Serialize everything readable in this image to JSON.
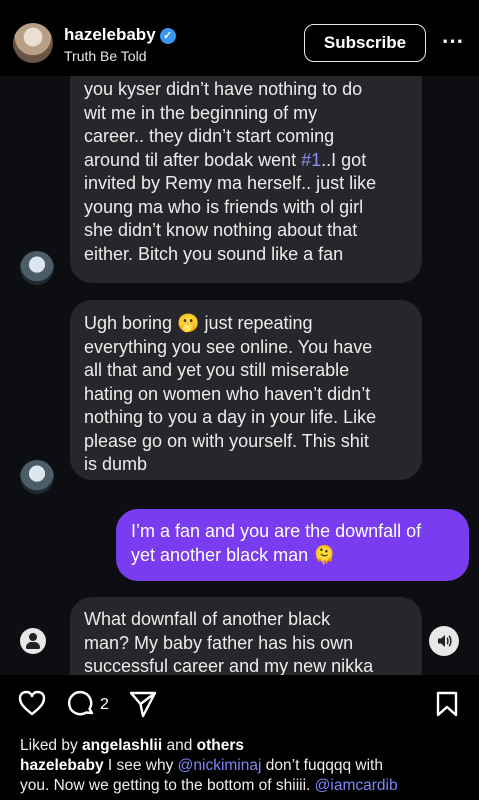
{
  "header": {
    "username": "hazelebaby",
    "verified_mark": "✓",
    "subtitle": "Truth Be Told",
    "subscribe_label": "Subscribe",
    "more_icon": "⋯"
  },
  "messages": [
    {
      "lines": [
        "you kyser didn’t have nothing to do",
        "wit me in the beginning of my",
        "career.. they didn’t start coming",
        "around til after bodak went ",
        "invited by Remy ma herself.. just like",
        "young ma who is friends with ol girl",
        "she didn’t know nothing about that",
        "either. Bitch you sound like a fan"
      ],
      "hashtag": "#1",
      "after_hashtag": "..I got"
    },
    {
      "lines": [
        "Ugh boring 🫢 just repeating",
        "everything you see online. You have",
        "all that and yet you still miserable",
        "hating on women who haven’t didn’t",
        "nothing to you a day in your life. Like",
        "please go on with yourself. This shit",
        "is dumb"
      ]
    },
    {
      "lines": [
        "I’m a fan and you are the downfall of",
        "yet another black man 🫠"
      ]
    },
    {
      "lines": [
        "What downfall of another black",
        "man? My baby father has his own",
        "successful career and my new nikka"
      ]
    }
  ],
  "actions": {
    "comment_count": "2"
  },
  "caption": {
    "liked_prefix": "Liked by ",
    "liked_user": "angelashlii",
    "liked_and": " and ",
    "liked_others": "others",
    "author": "hazelebaby",
    "text1": " I see why ",
    "mention1": "@nickiminaj",
    "text2": " don’t fuqqqq with",
    "text3": "you. Now we getting to the bottom of shiiii. ",
    "mention2": "@iamcardib"
  },
  "colors": {
    "outgoing_bubble": "#7a3cf0",
    "incoming_bubble": "#26272b",
    "link": "#8b8ff5",
    "verified": "#3897f0"
  }
}
